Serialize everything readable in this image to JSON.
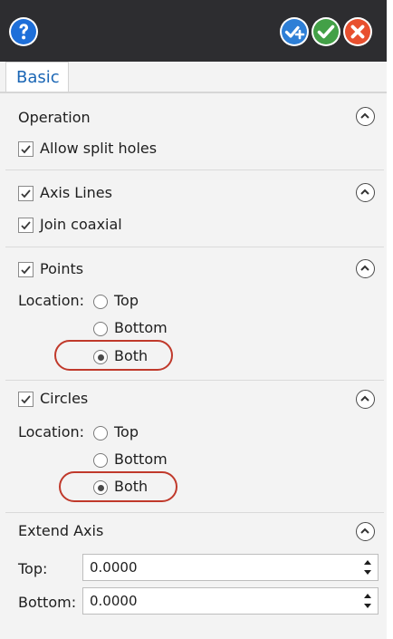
{
  "header": {
    "buttons": [
      {
        "name": "help",
        "icon": "help-icon",
        "color": "#1e6fd9"
      },
      {
        "name": "apply",
        "icon": "apply-icon",
        "color": "#2e7fd6"
      },
      {
        "name": "ok",
        "icon": "check-icon",
        "color": "#43a047"
      },
      {
        "name": "cancel",
        "icon": "close-icon",
        "color": "#e8502f"
      }
    ]
  },
  "tab": {
    "label": "Basic"
  },
  "operation": {
    "title": "Operation",
    "allow_split_holes": {
      "label": "Allow split holes",
      "checked": true
    }
  },
  "axis_lines": {
    "label": "Axis Lines",
    "checked": true,
    "join_coaxial": {
      "label": "Join coaxial",
      "checked": true
    }
  },
  "points": {
    "label": "Points",
    "checked": true,
    "location_label": "Location:",
    "options": [
      "Top",
      "Bottom",
      "Both"
    ],
    "selected": "Both"
  },
  "circles": {
    "label": "Circles",
    "checked": true,
    "location_label": "Location:",
    "options": [
      "Top",
      "Bottom",
      "Both"
    ],
    "selected": "Both"
  },
  "extend_axis": {
    "title": "Extend Axis",
    "top": {
      "label": "Top:",
      "value": "0.0000"
    },
    "bottom": {
      "label": "Bottom:",
      "value": "0.0000"
    }
  },
  "colors": {
    "highlight_ring": "#c0392b",
    "tab_text": "#1a66b5",
    "header_bg": "#2d2d30"
  }
}
